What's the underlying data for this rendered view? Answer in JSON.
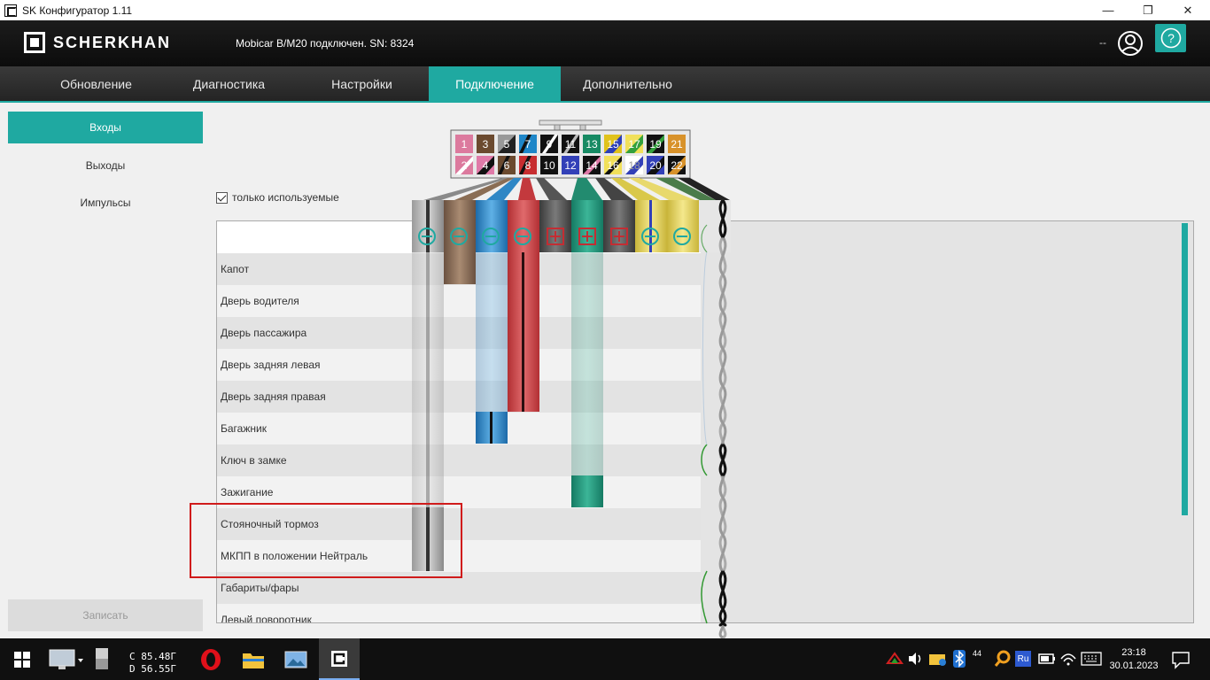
{
  "window": {
    "title": "SK Конфигуратор 1.11",
    "minimize": "—",
    "maximize": "❐",
    "close": "✕"
  },
  "header": {
    "logo": "SCHERKHAN",
    "connection_status": "Mobicar B/M20 подключен. SN: 8324",
    "user_dashes": "--",
    "help": "?"
  },
  "nav": {
    "tabs": [
      "Обновление",
      "Диагностика",
      "Настройки",
      "Подключение",
      "Дополнительно"
    ],
    "active_index": 3
  },
  "sidebar": {
    "items": [
      "Входы",
      "Выходы",
      "Импульсы"
    ],
    "active_index": 0,
    "write_button": "Записать"
  },
  "filter": {
    "only_used_label": "только используемые",
    "checked": true
  },
  "connector": {
    "top_pins": [
      "1",
      "3",
      "5",
      "7",
      "9",
      "11",
      "13",
      "15",
      "17",
      "19",
      "21"
    ],
    "bottom_pins": [
      "2",
      "4",
      "6",
      "8",
      "10",
      "12",
      "14",
      "16",
      "18",
      "20",
      "22"
    ]
  },
  "table": {
    "rows": [
      "Капот",
      "Дверь водителя",
      "Дверь пассажира",
      "Дверь задняя левая",
      "Дверь задняя правая",
      "Багажник",
      "Ключ в замке",
      "Зажигание",
      "Стояночный тормоз",
      "МКПП в положении Нейтраль",
      "Габариты/фары",
      "Левый поворотник"
    ]
  },
  "taskbar": {
    "disk_c": "C 85.48Г",
    "disk_d": "D 56.55Г",
    "lang": "Ru",
    "notify_count": "44",
    "time": "23:18",
    "date": "30.01.2023"
  },
  "colors": {
    "accent": "#1fa9a1",
    "highlight": "#d01b1b"
  }
}
